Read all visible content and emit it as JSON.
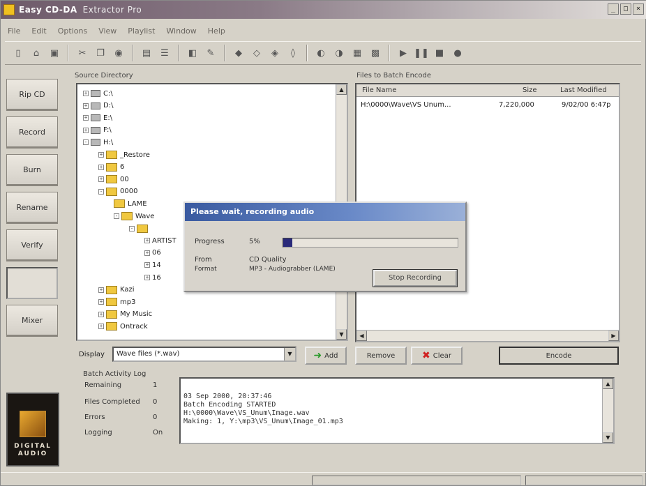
{
  "window": {
    "title": "Easy CD-DA",
    "subtitle": "Extractor Pro"
  },
  "menu": [
    "File",
    "Edit",
    "Options",
    "View",
    "Playlist",
    "Window",
    "Help"
  ],
  "nav": [
    "Rip CD",
    "Record",
    "Burn",
    "Rename",
    "Verify",
    "",
    "Mixer"
  ],
  "logo": {
    "line1": "DIGITAL",
    "line2": "AUDIO"
  },
  "tree": {
    "label": "Source Directory",
    "rows": [
      {
        "indent": 0,
        "exp": "+",
        "icon": "drive",
        "text": "C:\\"
      },
      {
        "indent": 0,
        "exp": "+",
        "icon": "drive",
        "text": "D:\\"
      },
      {
        "indent": 0,
        "exp": "+",
        "icon": "drive",
        "text": "E:\\"
      },
      {
        "indent": 0,
        "exp": "+",
        "icon": "drive",
        "text": "F:\\"
      },
      {
        "indent": 0,
        "exp": "-",
        "icon": "drive",
        "text": "H:\\"
      },
      {
        "indent": 1,
        "exp": "+",
        "icon": "folder",
        "text": "_Restore"
      },
      {
        "indent": 1,
        "exp": "+",
        "icon": "folder",
        "text": "6"
      },
      {
        "indent": 1,
        "exp": "+",
        "icon": "folder",
        "text": "00"
      },
      {
        "indent": 1,
        "exp": "-",
        "icon": "folder",
        "text": "0000"
      },
      {
        "indent": 2,
        "exp": "",
        "icon": "folder",
        "text": "LAME"
      },
      {
        "indent": 2,
        "exp": "-",
        "icon": "folder",
        "text": "Wave"
      },
      {
        "indent": 3,
        "exp": "-",
        "icon": "folder",
        "text": ""
      },
      {
        "indent": 4,
        "exp": "+",
        "icon": "",
        "text": "ARTIST"
      },
      {
        "indent": 4,
        "exp": "+",
        "icon": "",
        "text": "06"
      },
      {
        "indent": 4,
        "exp": "+",
        "icon": "",
        "text": "14"
      },
      {
        "indent": 4,
        "exp": "+",
        "icon": "",
        "text": "16"
      },
      {
        "indent": 1,
        "exp": "+",
        "icon": "folder",
        "text": "Kazi"
      },
      {
        "indent": 1,
        "exp": "+",
        "icon": "folder",
        "text": "mp3"
      },
      {
        "indent": 1,
        "exp": "+",
        "icon": "folder",
        "text": "My Music"
      },
      {
        "indent": 1,
        "exp": "+",
        "icon": "folder",
        "text": "Ontrack"
      }
    ]
  },
  "files": {
    "label": "Files to Batch Encode",
    "columns": [
      "File Name",
      "Size",
      "Last Modified"
    ],
    "rows": [
      {
        "name": "H:\\0000\\Wave\\VS Unum...",
        "size": "7,220,000",
        "modified": "9/02/00 6:47p"
      }
    ]
  },
  "dialog": {
    "title": "Please wait, recording audio",
    "progress_label": "Progress",
    "progress_value": "5%",
    "progress_fraction": 0.05,
    "from_label": "From",
    "from_value": "CD Quality",
    "format_label": "Format",
    "format_value": "MP3 - Audiograbber (LAME)",
    "stop_button": "Stop Recording"
  },
  "controls": {
    "display_label": "Display",
    "display_value": "Wave files (*.wav)",
    "add_label": "Add",
    "remove_label": "Remove",
    "clear_label": "Clear",
    "encode_label": "Encode"
  },
  "log": {
    "title": "Batch Activity Log",
    "stats": [
      {
        "label": "Remaining",
        "value": "1"
      },
      {
        "label": "Files Completed",
        "value": "0"
      },
      {
        "label": "Errors",
        "value": "0"
      },
      {
        "label": "Logging",
        "value": "On"
      }
    ],
    "lines": [
      "03 Sep 2000, 20:37:46",
      "Batch Encoding STARTED",
      "H:\\0000\\Wave\\VS_Unum\\Image.wav",
      "        Making: 1, Y:\\mp3\\VS_Unum\\Image_01.mp3"
    ]
  }
}
